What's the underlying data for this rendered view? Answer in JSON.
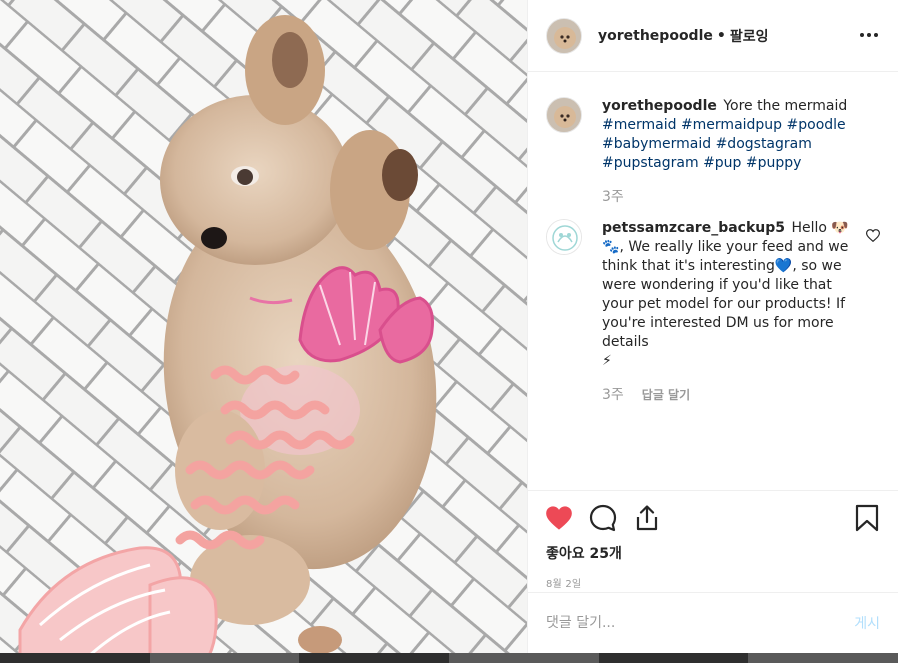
{
  "post": {
    "username": "yorethepoodle",
    "separator": "•",
    "follow_state": "팔로잉",
    "photo_alt": "Poodle lying on white herringbone tiles with pink mermaid doodles"
  },
  "comments": [
    {
      "username": "yorethepoodle",
      "text": "Yore the mermaid",
      "hashtags": [
        "#mermaid",
        "#mermaidpup",
        "#poodle",
        "#babymermaid",
        "#dogstagram",
        "#pupstagram",
        "#pup",
        "#puppy"
      ],
      "time": "3주"
    },
    {
      "username": "petssamzcare_backup5",
      "text_1": "Hello",
      "emoji_1": "🐶🐾",
      "text_2": ", We really like your feed and we think that it's interesting",
      "emoji_2": "💙",
      "text_3": ", so we were wondering if you'd like that your pet model for our products! If you're interested DM us for more details",
      "emoji_3": "⚡",
      "time": "3주",
      "reply_label": "답글 달기"
    }
  ],
  "actions": {
    "likes": "좋아요 25개",
    "date": "8월 2일",
    "liked": true,
    "like_color": "#ed4956"
  },
  "comment_box": {
    "placeholder": "댓글 달기...",
    "post_label": "게시"
  }
}
